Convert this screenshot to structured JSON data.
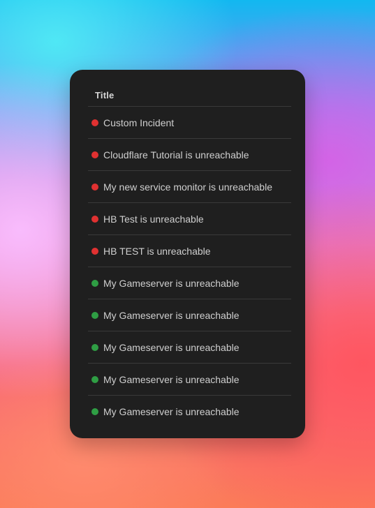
{
  "table": {
    "column_header": "Title",
    "status_colors": {
      "down": "#e03131",
      "up": "#2f9e44"
    },
    "rows": [
      {
        "title": "Custom Incident",
        "status": "down",
        "status_color": "#e03131",
        "status_icon": "status-dot-icon"
      },
      {
        "title": "Cloudflare Tutorial is unreachable",
        "status": "down",
        "status_color": "#e03131",
        "status_icon": "status-dot-icon"
      },
      {
        "title": "My new service monitor is unreachable",
        "status": "down",
        "status_color": "#e03131",
        "status_icon": "status-dot-icon"
      },
      {
        "title": "HB Test is unreachable",
        "status": "down",
        "status_color": "#e03131",
        "status_icon": "status-dot-icon"
      },
      {
        "title": "HB TEST is unreachable",
        "status": "down",
        "status_color": "#e03131",
        "status_icon": "status-dot-icon"
      },
      {
        "title": "My Gameserver is unreachable",
        "status": "up",
        "status_color": "#2f9e44",
        "status_icon": "status-dot-icon"
      },
      {
        "title": "My Gameserver is unreachable",
        "status": "up",
        "status_color": "#2f9e44",
        "status_icon": "status-dot-icon"
      },
      {
        "title": "My Gameserver is unreachable",
        "status": "up",
        "status_color": "#2f9e44",
        "status_icon": "status-dot-icon"
      },
      {
        "title": "My Gameserver is unreachable",
        "status": "up",
        "status_color": "#2f9e44",
        "status_icon": "status-dot-icon"
      },
      {
        "title": "My Gameserver is unreachable",
        "status": "up",
        "status_color": "#2f9e44",
        "status_icon": "status-dot-icon"
      }
    ]
  }
}
